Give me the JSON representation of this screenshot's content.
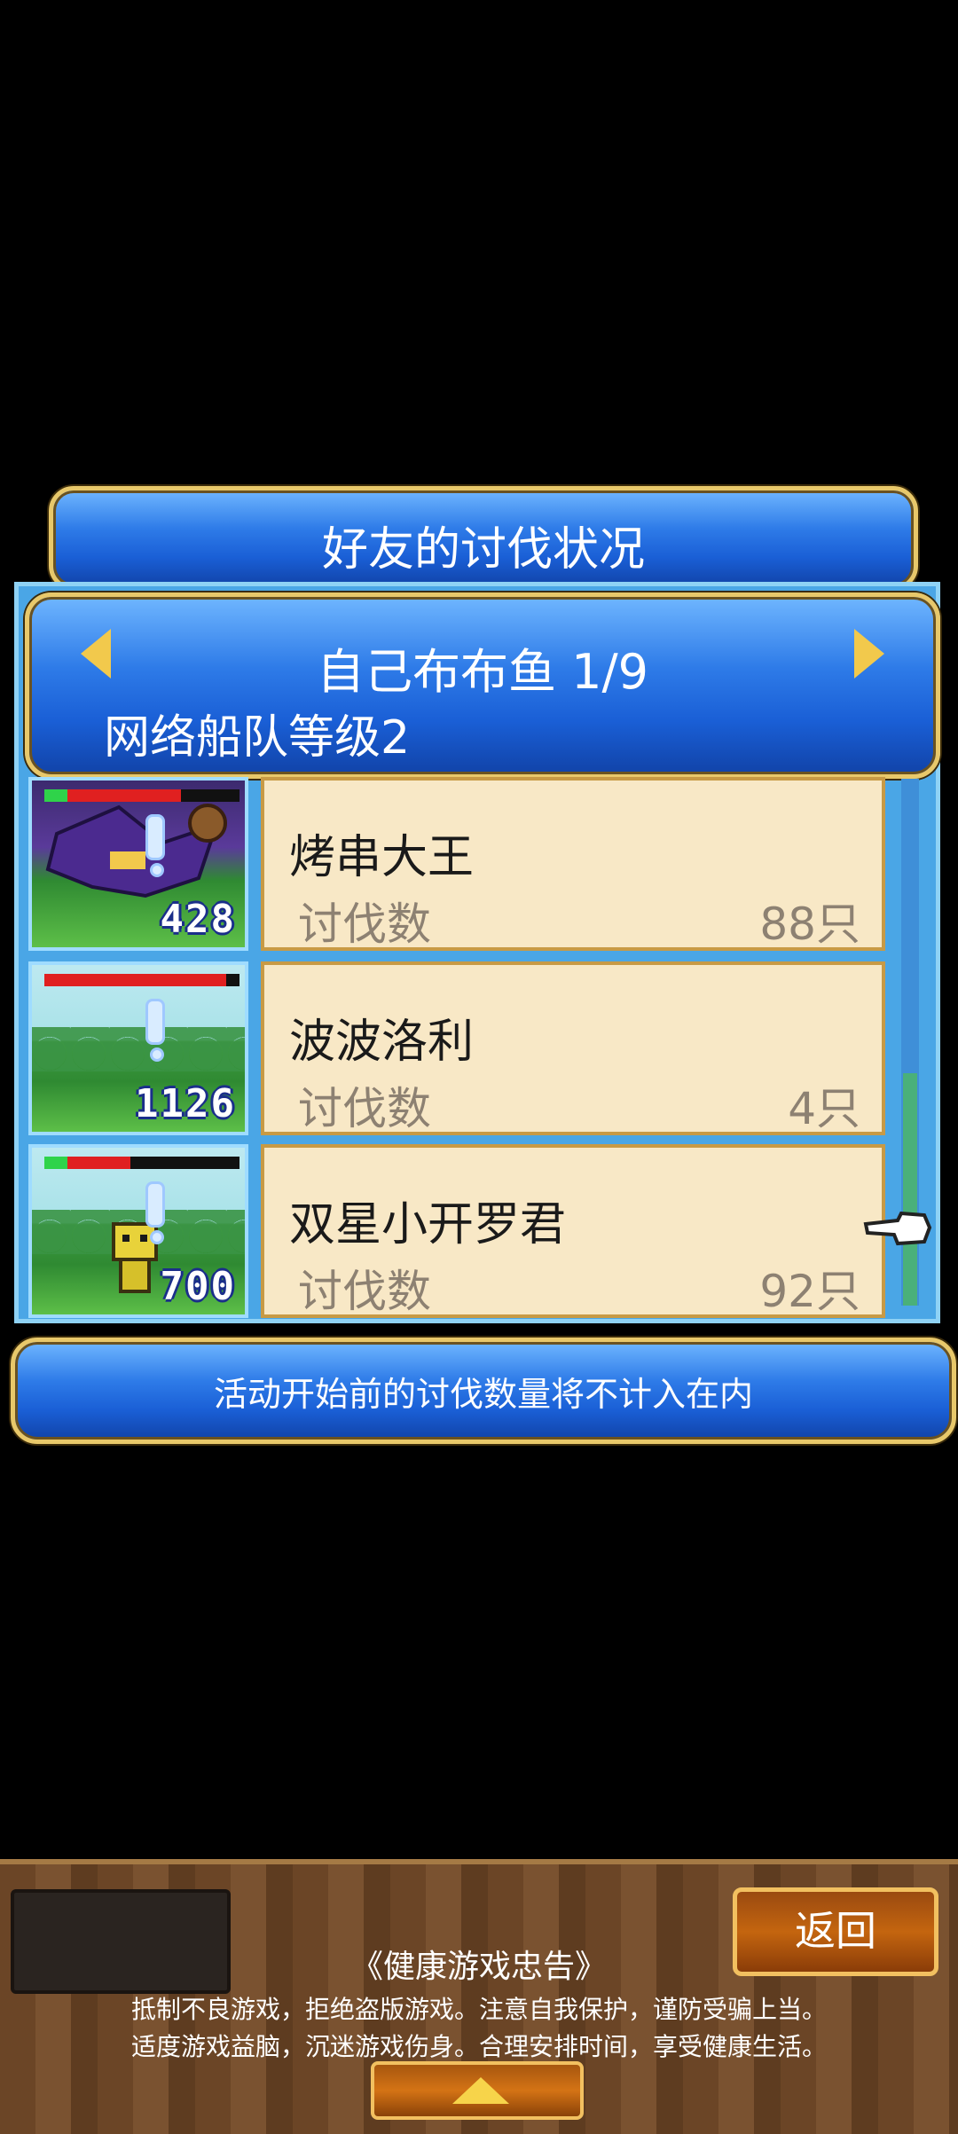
{
  "dialog": {
    "title": "好友的讨伐状况",
    "player_name": "自己布布鱼 1/9",
    "fleet_level": "网络船队等级2"
  },
  "friends": [
    {
      "name": "烤串大王",
      "label": "讨伐数",
      "count": "88只",
      "thumb_number": "428",
      "hp_fraction": 0.7
    },
    {
      "name": "波波洛利",
      "label": "讨伐数",
      "count": "4只",
      "thumb_number": "1126",
      "hp_fraction": 0.93
    },
    {
      "name": "双星小开罗君",
      "label": "讨伐数",
      "count": "92只",
      "thumb_number": "700",
      "hp_fraction": 0.44
    }
  ],
  "notice": "活动开始前的讨伐数量将不计入在内",
  "footer": {
    "back_label": "返回",
    "health_title": "《健康游戏忠告》",
    "health_line_1": "抵制不良游戏，拒绝盗版游戏。注意自我保护，谨防受骗上当。",
    "health_line_2": "适度游戏益脑，沉迷游戏伤身。合理安排时间，享受健康生活。"
  },
  "colors": {
    "dialog_blue": "#1a5fd6",
    "frame_gold": "#e8c86a",
    "card_bg": "#f8e8c6",
    "panel_blue": "#4aa6e6"
  },
  "icons": [
    "chevron-left-icon",
    "chevron-right-icon",
    "pointing-hand-icon",
    "up-arrow-icon"
  ]
}
